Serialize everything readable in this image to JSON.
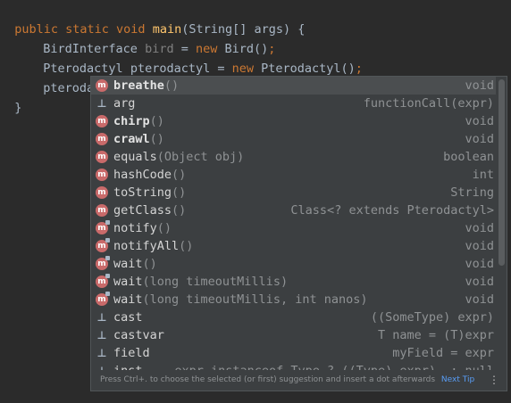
{
  "code": {
    "line1": {
      "kw": "public static void ",
      "fn": "main",
      "rest": "(String[] args) {"
    },
    "line2": {
      "type": "BirdInterface ",
      "var": "bird",
      "eq": " = ",
      "kw": "new ",
      "call": "Bird()",
      "semi": ";"
    },
    "line3": {
      "type": "Pterodactyl ",
      "var": "pterodactyl",
      "eq": " = ",
      "kw": "new ",
      "call": "Pterodactyl()",
      "semi": ";"
    },
    "line4": {
      "text": "pterodactyl."
    },
    "line5": {
      "text": "}"
    }
  },
  "completion": {
    "items": [
      {
        "name": "breathe",
        "params": "()",
        "type": "void",
        "icon": "m",
        "bold": true
      },
      {
        "name": "arg",
        "params": "",
        "type": "functionCall(expr)",
        "icon": "template"
      },
      {
        "name": "chirp",
        "params": "()",
        "type": "void",
        "icon": "m",
        "bold": true
      },
      {
        "name": "crawl",
        "params": "()",
        "type": "void",
        "icon": "m",
        "bold": true
      },
      {
        "name": "equals",
        "params": "(Object obj)",
        "type": "boolean",
        "icon": "m"
      },
      {
        "name": "hashCode",
        "params": "()",
        "type": "int",
        "icon": "m"
      },
      {
        "name": "toString",
        "params": "()",
        "type": "String",
        "icon": "m"
      },
      {
        "name": "getClass",
        "params": "()",
        "type": "Class<? extends Pterodactyl>",
        "icon": "m"
      },
      {
        "name": "notify",
        "params": "()",
        "type": "void",
        "icon": "m-lock"
      },
      {
        "name": "notifyAll",
        "params": "()",
        "type": "void",
        "icon": "m-lock"
      },
      {
        "name": "wait",
        "params": "()",
        "type": "void",
        "icon": "m-lock"
      },
      {
        "name": "wait",
        "params": "(long timeoutMillis)",
        "type": "void",
        "icon": "m-lock"
      },
      {
        "name": "wait",
        "params": "(long timeoutMillis, int nanos)",
        "type": "void",
        "icon": "m-lock"
      },
      {
        "name": "cast",
        "params": "",
        "type": "((SomeType) expr)",
        "icon": "template"
      },
      {
        "name": "castvar",
        "params": "",
        "type": "T name = (T)expr",
        "icon": "template"
      },
      {
        "name": "field",
        "params": "",
        "type": "myField = expr",
        "icon": "template"
      },
      {
        "name": "inst",
        "params": "",
        "type": "expr instanceof Type ? ((Type) expr). : null",
        "icon": "template"
      }
    ],
    "footer_text": "Press Ctrl+. to choose the selected (or first) suggestion and insert a dot afterwards",
    "footer_tip": "Next Tip",
    "footer_menu": "⋮"
  }
}
